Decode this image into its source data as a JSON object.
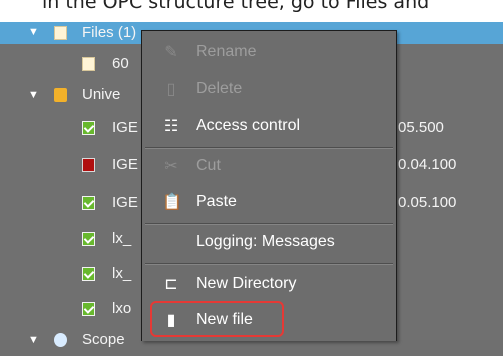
{
  "caption": "in the OPC structure tree, go to Files and",
  "tree": {
    "files_label": "Files (1)",
    "file_item": "60",
    "unive_label": "Unive",
    "items": [
      {
        "label": "IGE",
        "value": "05.500",
        "status": "checked"
      },
      {
        "label": "IGE",
        "value": "0.04.100",
        "status": "error"
      },
      {
        "label": "IGE",
        "value": "0.05.100",
        "status": "checked"
      },
      {
        "label": "lx_",
        "value": "",
        "status": "checked"
      },
      {
        "label": "lx_",
        "value": "",
        "status": "checked"
      },
      {
        "label": "lxo",
        "value": "",
        "status": "checked"
      }
    ],
    "bottom_label": "Scope"
  },
  "menu": {
    "rename": "Rename",
    "delete": "Delete",
    "access_control": "Access control",
    "cut": "Cut",
    "paste": "Paste",
    "logging": "Logging: Messages",
    "new_directory": "New Directory",
    "new_file": "New file"
  },
  "colors": {
    "selection": "#57a5d6",
    "highlight_box": "#e53935",
    "background": "#707070"
  }
}
